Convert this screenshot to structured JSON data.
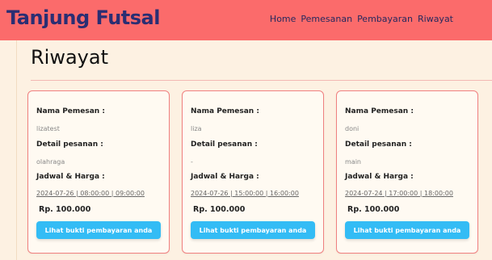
{
  "brand": "Tanjung Futsal",
  "nav": {
    "items": [
      "Home",
      "Pemesanan",
      "Pembayaran",
      "Riwayat"
    ]
  },
  "page_title": "Riwayat",
  "labels": {
    "nama_pemesan": "Nama Pemesan :",
    "detail_pesanan": "Detail pesanan :",
    "jadwal_harga": "Jadwal & Harga :"
  },
  "cards": [
    {
      "nama": "lizatest",
      "detail": "olahraga",
      "jadwal": "2024-07-26 | 08:00:00 | 09:00:00",
      "harga": "Rp. 100.000",
      "button": "Lihat bukti pembayaran anda"
    },
    {
      "nama": "liza",
      "detail": "-",
      "jadwal": "2024-07-26 | 15:00:00 | 16:00:00",
      "harga": "Rp. 100.000",
      "button": "Lihat bukti pembayaran anda"
    },
    {
      "nama": "doni",
      "detail": "main",
      "jadwal": "2024-07-24 | 17:00:00 | 18:00:00",
      "harga": "Rp. 100.000",
      "button": "Lihat bukti pembayaran anda"
    }
  ],
  "colors": {
    "navbar": "#fb6b6b",
    "brand": "#2a2e73",
    "background": "#fdf1e2",
    "card_border": "#f08080",
    "button": "#33bcf5"
  }
}
